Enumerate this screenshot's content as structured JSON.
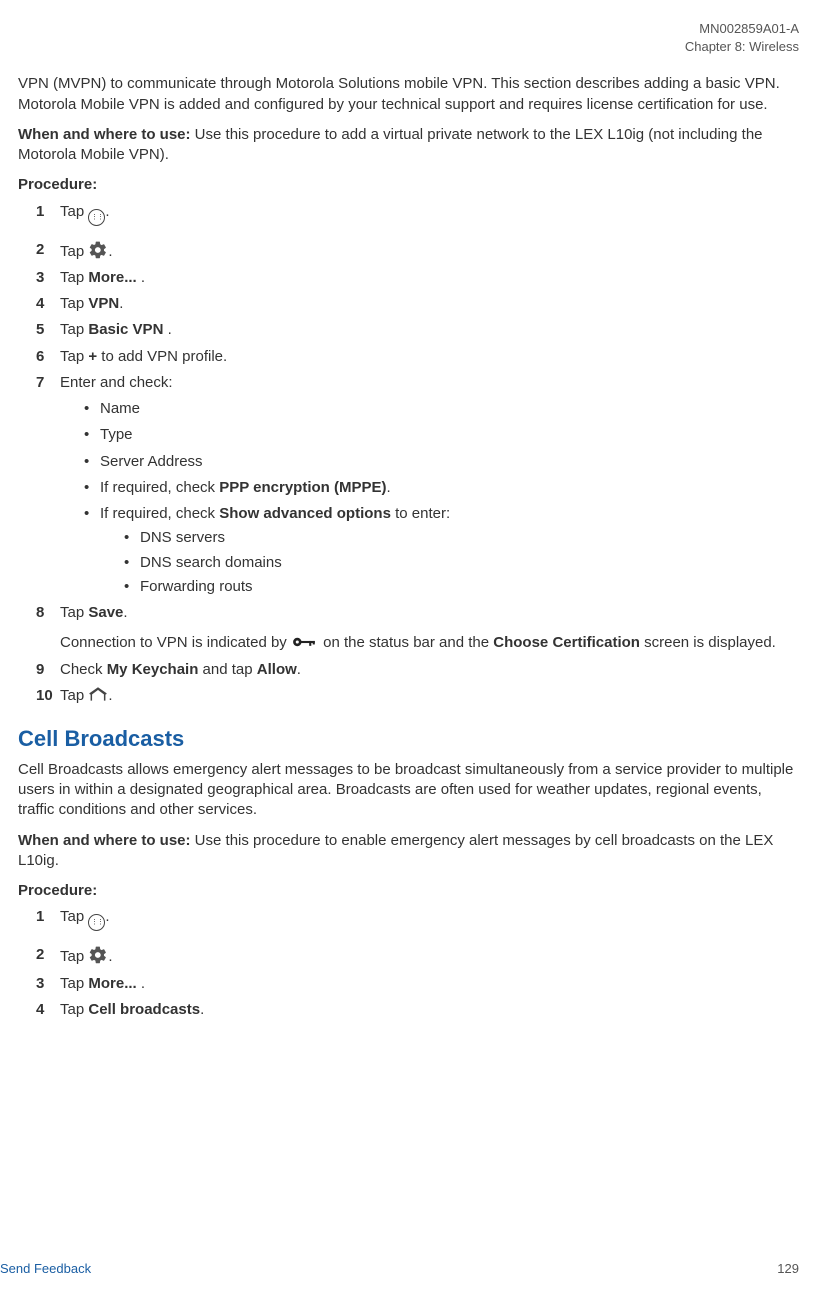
{
  "header": {
    "doc_id": "MN002859A01-A",
    "chapter": "Chapter 8:  Wireless"
  },
  "intro_paragraph": "VPN (MVPN) to communicate through Motorola Solutions mobile VPN. This section describes adding a basic VPN. Motorola Mobile VPN is added and configured by your technical support and requires license certification for use.",
  "when_where_label": "When and where to use:",
  "when_where_text": " Use this procedure to add a virtual private network to the LEX L10ig (not including the Motorola Mobile VPN).",
  "procedure_label": "Procedure:",
  "steps": {
    "s1": "Tap ",
    "s1_after": ".",
    "s2": "Tap ",
    "s2_after": ".",
    "s3_a": "Tap ",
    "s3_b": "More...",
    "s3_c": " .",
    "s4_a": "Tap ",
    "s4_b": "VPN",
    "s4_c": ".",
    "s5_a": "Tap ",
    "s5_b": "Basic VPN",
    "s5_c": " .",
    "s6_a": "Tap ",
    "s6_b": "+",
    "s6_c": " to add VPN profile.",
    "s7": "Enter and check:",
    "b1": "Name",
    "b2": "Type",
    "b3": "Server Address",
    "b4_a": "If required, check ",
    "b4_b": "PPP encryption (MPPE)",
    "b4_c": ".",
    "b5_a": "If required, check ",
    "b5_b": "Show advanced options",
    "b5_c": " to enter:",
    "bb1": "DNS servers",
    "bb2": "DNS search domains",
    "bb3": "Forwarding routs",
    "s8_a": "Tap ",
    "s8_b": "Save",
    "s8_c": ".",
    "s8_sub_a": "Connection to VPN is indicated by ",
    "s8_sub_b": " on the status bar and the ",
    "s8_sub_c": "Choose Certification",
    "s8_sub_d": " screen is displayed.",
    "s9_a": "Check ",
    "s9_b": "My Keychain",
    "s9_c": " and tap ",
    "s9_d": "Allow",
    "s9_e": ".",
    "s10_a": "Tap ",
    "s10_b": "."
  },
  "section2": {
    "title": "Cell Broadcasts",
    "intro": "Cell Broadcasts allows emergency alert messages to be broadcast simultaneously from a service provider to multiple users in within a designated geographical area. Broadcasts are often used for weather updates, regional events, traffic conditions and other services.",
    "when_where_label": "When and where to use:",
    "when_where_text": " Use this procedure to enable emergency alert messages by cell broadcasts on the LEX L10ig.",
    "procedure_label": "Procedure:",
    "s1": "Tap ",
    "s1_after": ".",
    "s2": "Tap ",
    "s2_after": ".",
    "s3_a": "Tap ",
    "s3_b": "More...",
    "s3_c": " .",
    "s4_a": "Tap ",
    "s4_b": "Cell broadcasts",
    "s4_c": "."
  },
  "footer": {
    "feedback": "Send Feedback",
    "page": "129"
  },
  "nums": {
    "n1": "1",
    "n2": "2",
    "n3": "3",
    "n4": "4",
    "n5": "5",
    "n6": "6",
    "n7": "7",
    "n8": "8",
    "n9": "9",
    "n10": "10"
  }
}
